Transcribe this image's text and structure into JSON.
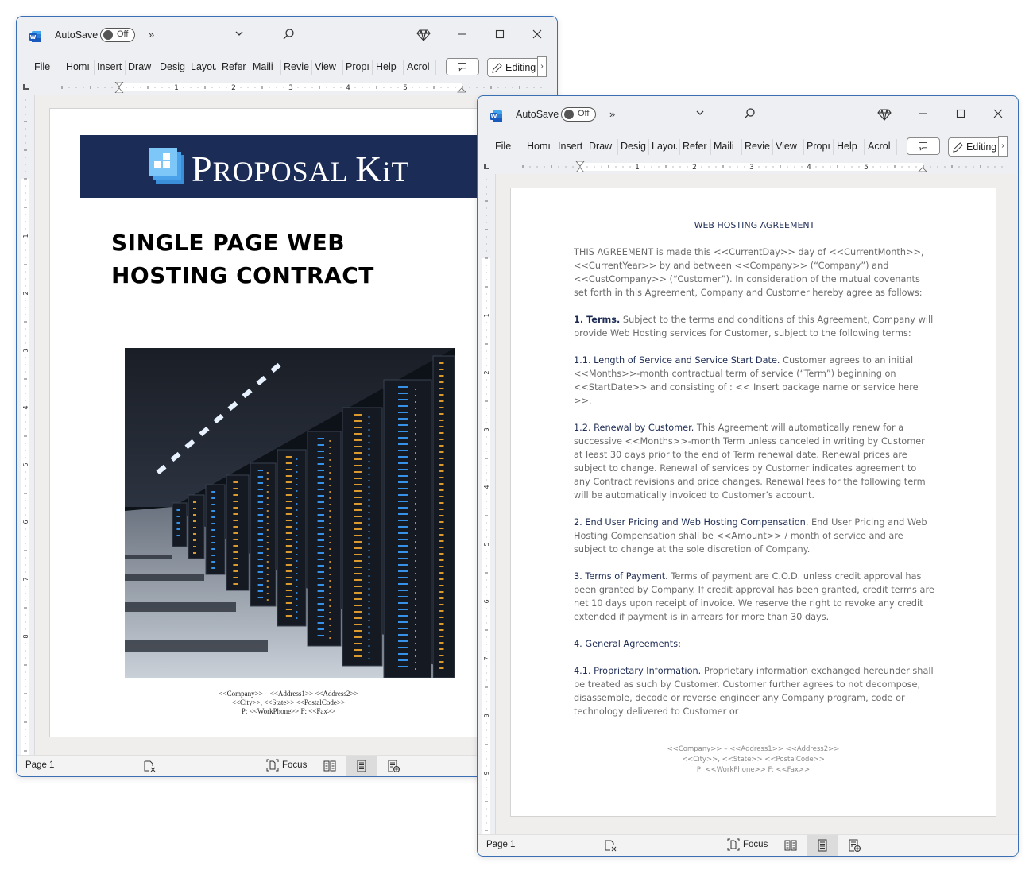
{
  "colors": {
    "window_border": "#3a6fb5",
    "banner_bg": "#1b2d57",
    "heading_navy": "#1f2d55",
    "body_gray": "#6a6a6a",
    "logo_blue": "#5db6f0"
  },
  "windows": [
    {
      "titlebar": {
        "app_icon": "word-icon",
        "autosave_label": "AutoSave",
        "autosave_state": "Off",
        "more_label": "»"
      },
      "ribbon": {
        "tabs": [
          "File",
          "Home",
          "Insert",
          "Draw",
          "Design",
          "Layout",
          "References",
          "Mailings",
          "Review",
          "View",
          "Properties",
          "Help",
          "Acrobat"
        ],
        "tabs_visible": [
          "File",
          "Homı",
          "Insert",
          "Draw",
          "Desig",
          "Layou",
          "Refer",
          "Maili",
          "Revie",
          "View",
          "Propı",
          "Help",
          "Acrol"
        ],
        "editing_label": "Editing"
      },
      "ruler_numbers": [
        "1",
        "2",
        "3",
        "4",
        "5"
      ],
      "vruler_numbers": [
        "1",
        "2",
        "3",
        "4",
        "5",
        "6",
        "7",
        "8"
      ],
      "status": {
        "page_label": "Page 1",
        "focus_label": "Focus"
      },
      "document": {
        "brand_name_first": "P",
        "brand_name_rest": "ROPOSAL ",
        "brand_name_k": "K",
        "brand_name_end": "iT",
        "cover_title_line1": "SINGLE PAGE WEB",
        "cover_title_line2": "HOSTING CONTRACT",
        "image_description": "server-room-photo",
        "footer_line1": "<<Company>> – <<Address1>> <<Address2>>",
        "footer_line2": "<<City>>, <<State>> <<PostalCode>>",
        "footer_line3": "P: <<WorkPhone>>  F: <<Fax>>"
      }
    },
    {
      "titlebar": {
        "app_icon": "word-icon",
        "autosave_label": "AutoSave",
        "autosave_state": "Off",
        "more_label": "»"
      },
      "ribbon": {
        "tabs_visible": [
          "File",
          "Homı",
          "Insert",
          "Draw",
          "Desig",
          "Layou",
          "Refer",
          "Maili",
          "Revie",
          "View",
          "Propı",
          "Help",
          "Acrol"
        ],
        "editing_label": "Editing"
      },
      "ruler_numbers": [
        "1",
        "2",
        "3",
        "4",
        "5"
      ],
      "vruler_numbers": [
        "1",
        "2",
        "3",
        "4",
        "5",
        "6",
        "7",
        "8",
        "9"
      ],
      "status": {
        "page_label": "Page 1",
        "focus_label": "Focus"
      },
      "document": {
        "title": "WEB HOSTING AGREEMENT",
        "intro": "THIS AGREEMENT is made this <<CurrentDay>> day of <<CurrentMonth>>, <<CurrentYear>> by and between <<Company>> (“Company”) and <<CustCompany>> (“Customer”). In consideration of the mutual covenants set forth in this Agreement, Company and Customer hereby agree as follows:",
        "sections": [
          {
            "heading": "1. Terms.",
            "text": " Subject to the terms and conditions of this Agreement, Company will provide Web Hosting services for Customer, subject to the following terms:"
          },
          {
            "heading": "1.1. Length of Service and Service Start Date.",
            "text": " Customer agrees to an initial <<Months>>-month contractual term of service (“Term”) beginning on <<StartDate>> and consisting of :  << Insert package name or service here >>."
          },
          {
            "heading": "1.2. Renewal by Customer.",
            "text": " This Agreement will automatically renew for a successive <<Months>>-month Term unless canceled in writing by Customer at least 30 days prior to the end of Term renewal date. Renewal prices are subject to change. Renewal of services by Customer indicates agreement to any Contract revisions and price changes. Renewal fees for the following term will be automatically invoiced to Customer’s account."
          },
          {
            "heading": "2. End User Pricing and Web Hosting Compensation.",
            "text": " End User Pricing and Web Hosting Compensation shall be <<Amount>> / month of service and are subject to change at the sole discretion of Company."
          },
          {
            "heading": "3. Terms of Payment.",
            "text": " Terms of payment are C.O.D. unless credit approval has been granted by Company. If credit approval has been granted, credit terms are net 10 days upon receipt of invoice. We reserve the right to revoke any credit extended if payment is in arrears for more than 30 days."
          },
          {
            "heading": "4. General Agreements:",
            "text": ""
          },
          {
            "heading": "4.1. Proprietary Information.",
            "text": " Proprietary information exchanged hereunder shall be treated as such by Customer. Customer further agrees to not decompose, disassemble, decode or reverse engineer any Company program, code or technology delivered to Customer or"
          }
        ],
        "footer_line1": "<<Company>> – <<Address1>> <<Address2>>",
        "footer_line2": "<<City>>, <<State>> <<PostalCode>>",
        "footer_line3": "P: <<WorkPhone>>  F: <<Fax>>"
      }
    }
  ]
}
